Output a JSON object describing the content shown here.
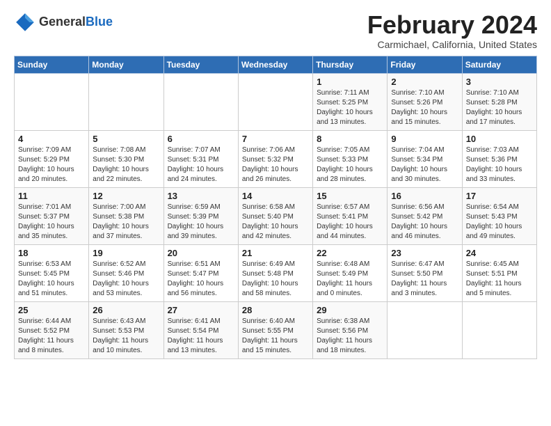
{
  "logo": {
    "line1": "General",
    "line2": "Blue"
  },
  "title": "February 2024",
  "subtitle": "Carmichael, California, United States",
  "days_of_week": [
    "Sunday",
    "Monday",
    "Tuesday",
    "Wednesday",
    "Thursday",
    "Friday",
    "Saturday"
  ],
  "weeks": [
    [
      {
        "day": "",
        "info": ""
      },
      {
        "day": "",
        "info": ""
      },
      {
        "day": "",
        "info": ""
      },
      {
        "day": "",
        "info": ""
      },
      {
        "day": "1",
        "info": "Sunrise: 7:11 AM\nSunset: 5:25 PM\nDaylight: 10 hours\nand 13 minutes."
      },
      {
        "day": "2",
        "info": "Sunrise: 7:10 AM\nSunset: 5:26 PM\nDaylight: 10 hours\nand 15 minutes."
      },
      {
        "day": "3",
        "info": "Sunrise: 7:10 AM\nSunset: 5:28 PM\nDaylight: 10 hours\nand 17 minutes."
      }
    ],
    [
      {
        "day": "4",
        "info": "Sunrise: 7:09 AM\nSunset: 5:29 PM\nDaylight: 10 hours\nand 20 minutes."
      },
      {
        "day": "5",
        "info": "Sunrise: 7:08 AM\nSunset: 5:30 PM\nDaylight: 10 hours\nand 22 minutes."
      },
      {
        "day": "6",
        "info": "Sunrise: 7:07 AM\nSunset: 5:31 PM\nDaylight: 10 hours\nand 24 minutes."
      },
      {
        "day": "7",
        "info": "Sunrise: 7:06 AM\nSunset: 5:32 PM\nDaylight: 10 hours\nand 26 minutes."
      },
      {
        "day": "8",
        "info": "Sunrise: 7:05 AM\nSunset: 5:33 PM\nDaylight: 10 hours\nand 28 minutes."
      },
      {
        "day": "9",
        "info": "Sunrise: 7:04 AM\nSunset: 5:34 PM\nDaylight: 10 hours\nand 30 minutes."
      },
      {
        "day": "10",
        "info": "Sunrise: 7:03 AM\nSunset: 5:36 PM\nDaylight: 10 hours\nand 33 minutes."
      }
    ],
    [
      {
        "day": "11",
        "info": "Sunrise: 7:01 AM\nSunset: 5:37 PM\nDaylight: 10 hours\nand 35 minutes."
      },
      {
        "day": "12",
        "info": "Sunrise: 7:00 AM\nSunset: 5:38 PM\nDaylight: 10 hours\nand 37 minutes."
      },
      {
        "day": "13",
        "info": "Sunrise: 6:59 AM\nSunset: 5:39 PM\nDaylight: 10 hours\nand 39 minutes."
      },
      {
        "day": "14",
        "info": "Sunrise: 6:58 AM\nSunset: 5:40 PM\nDaylight: 10 hours\nand 42 minutes."
      },
      {
        "day": "15",
        "info": "Sunrise: 6:57 AM\nSunset: 5:41 PM\nDaylight: 10 hours\nand 44 minutes."
      },
      {
        "day": "16",
        "info": "Sunrise: 6:56 AM\nSunset: 5:42 PM\nDaylight: 10 hours\nand 46 minutes."
      },
      {
        "day": "17",
        "info": "Sunrise: 6:54 AM\nSunset: 5:43 PM\nDaylight: 10 hours\nand 49 minutes."
      }
    ],
    [
      {
        "day": "18",
        "info": "Sunrise: 6:53 AM\nSunset: 5:45 PM\nDaylight: 10 hours\nand 51 minutes."
      },
      {
        "day": "19",
        "info": "Sunrise: 6:52 AM\nSunset: 5:46 PM\nDaylight: 10 hours\nand 53 minutes."
      },
      {
        "day": "20",
        "info": "Sunrise: 6:51 AM\nSunset: 5:47 PM\nDaylight: 10 hours\nand 56 minutes."
      },
      {
        "day": "21",
        "info": "Sunrise: 6:49 AM\nSunset: 5:48 PM\nDaylight: 10 hours\nand 58 minutes."
      },
      {
        "day": "22",
        "info": "Sunrise: 6:48 AM\nSunset: 5:49 PM\nDaylight: 11 hours\nand 0 minutes."
      },
      {
        "day": "23",
        "info": "Sunrise: 6:47 AM\nSunset: 5:50 PM\nDaylight: 11 hours\nand 3 minutes."
      },
      {
        "day": "24",
        "info": "Sunrise: 6:45 AM\nSunset: 5:51 PM\nDaylight: 11 hours\nand 5 minutes."
      }
    ],
    [
      {
        "day": "25",
        "info": "Sunrise: 6:44 AM\nSunset: 5:52 PM\nDaylight: 11 hours\nand 8 minutes."
      },
      {
        "day": "26",
        "info": "Sunrise: 6:43 AM\nSunset: 5:53 PM\nDaylight: 11 hours\nand 10 minutes."
      },
      {
        "day": "27",
        "info": "Sunrise: 6:41 AM\nSunset: 5:54 PM\nDaylight: 11 hours\nand 13 minutes."
      },
      {
        "day": "28",
        "info": "Sunrise: 6:40 AM\nSunset: 5:55 PM\nDaylight: 11 hours\nand 15 minutes."
      },
      {
        "day": "29",
        "info": "Sunrise: 6:38 AM\nSunset: 5:56 PM\nDaylight: 11 hours\nand 18 minutes."
      },
      {
        "day": "",
        "info": ""
      },
      {
        "day": "",
        "info": ""
      }
    ]
  ]
}
